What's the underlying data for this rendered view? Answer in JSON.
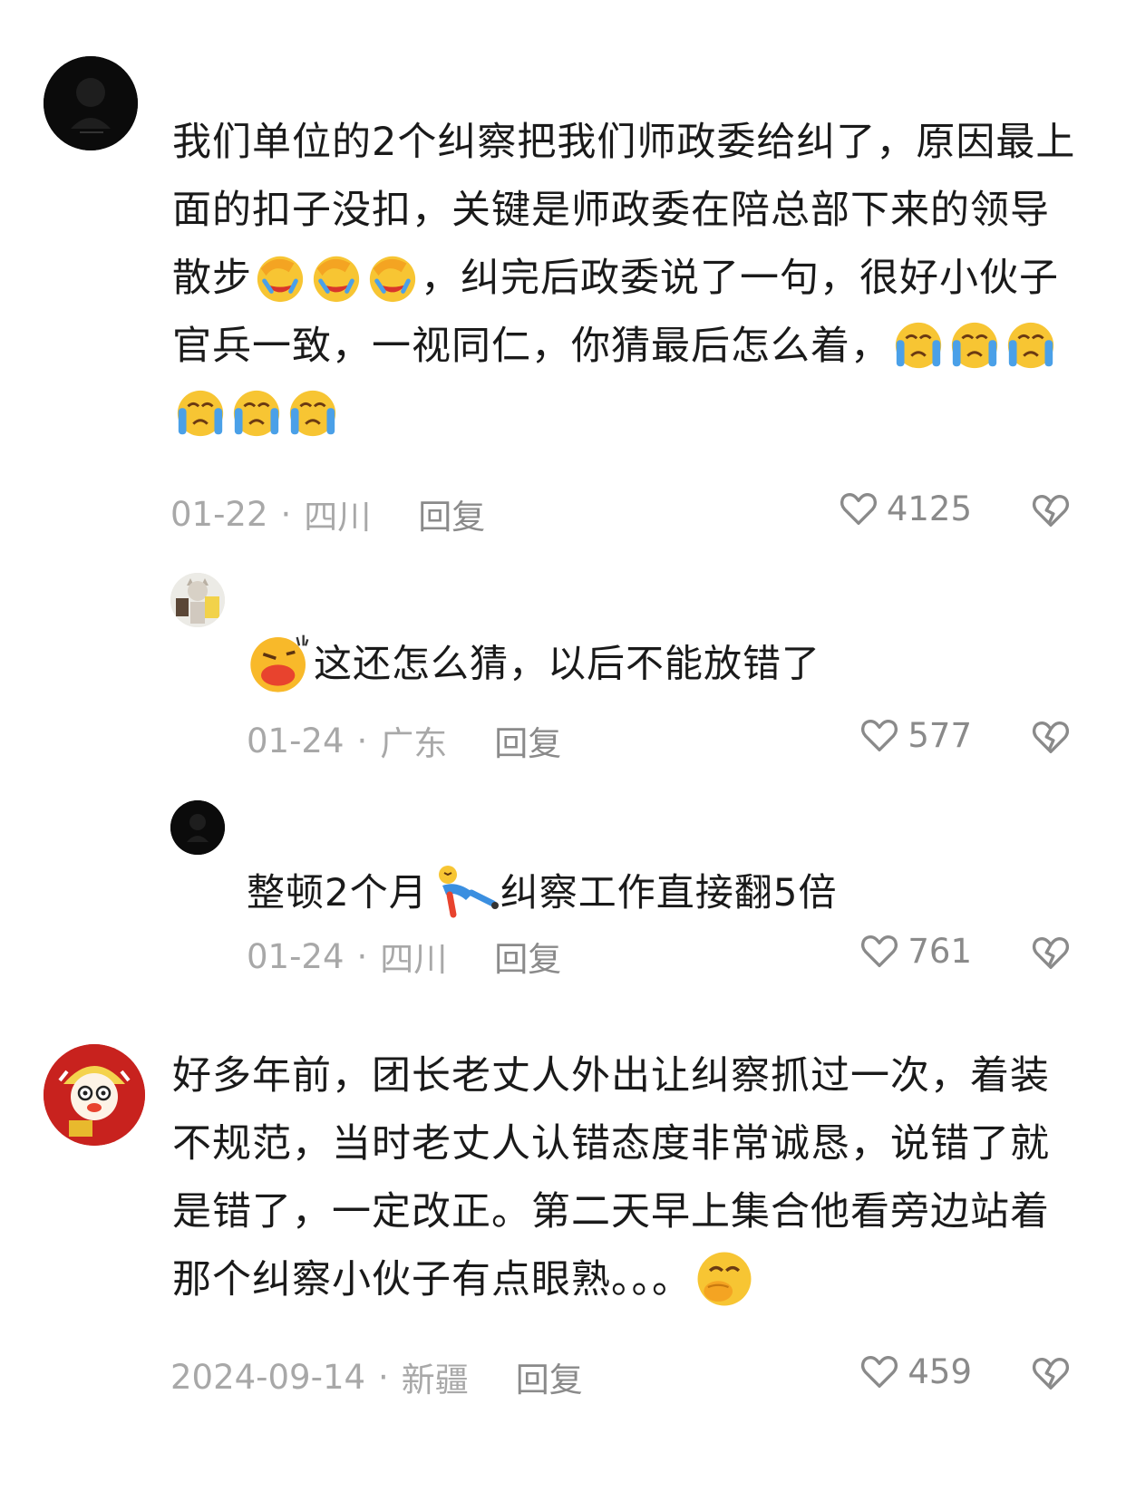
{
  "comments": [
    {
      "text_segments": [
        "我们单位的2个纠察把我们师政委给纠了，原因最上面的扣子没扣，关键是师政委在陪总部下来的领导散步",
        "，纠完后政委说了一句，很好小伙子 官兵一致，一视同仁，你猜最后怎么着，"
      ],
      "emojis": [
        "facepalm-laugh-emoji",
        "facepalm-laugh-emoji",
        "facepalm-laugh-emoji",
        "crying-emoji",
        "crying-emoji",
        "crying-emoji",
        "crying-emoji",
        "crying-emoji",
        "crying-emoji"
      ],
      "date": "01-22",
      "location": "四川",
      "reply_label": "回复",
      "likes": "4125",
      "replies": [
        {
          "emoji_prefix": "pouting-face-emoji",
          "text": "这还怎么猜，以后不能放错了",
          "date": "01-24",
          "location": "广东",
          "reply_label": "回复",
          "likes": "577"
        },
        {
          "text_before": "整顿2个月",
          "emoji_mid": "fallen-person-emoji",
          "text_after": "纠察工作直接翻5倍",
          "date": "01-24",
          "location": "四川",
          "reply_label": "回复",
          "likes": "761"
        }
      ]
    },
    {
      "text": "好多年前，团长老丈人外出让纠察抓过一次，着装不规范，当时老丈人认错态度非常诚恳，说错了就是错了，一定改正。第二天早上集合他看旁边站着那个纠察小伙子有点眼熟。。。",
      "emoji_suffix": "hand-over-mouth-emoji",
      "date": "2024-09-14",
      "location": "新疆",
      "reply_label": "回复",
      "likes": "459"
    }
  ],
  "separator": "·",
  "icons": {
    "like": "heart-outline-icon",
    "dislike": "broken-heart-icon"
  },
  "colors": {
    "text": "#1a1a1a",
    "meta": "#a8a8a8",
    "icon": "#8a8a8a"
  }
}
